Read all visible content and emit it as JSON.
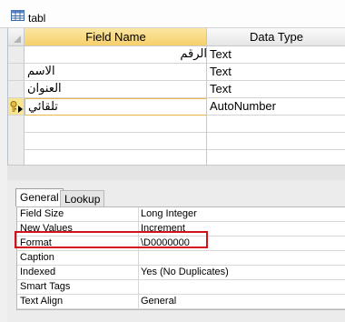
{
  "window": {
    "title": "tabl",
    "icon": "table-icon"
  },
  "grid": {
    "columns": [
      "Field Name",
      "Data Type"
    ],
    "rows": [
      {
        "name": "الرقم",
        "type": "Text"
      },
      {
        "name": "الاسم",
        "type": "Text"
      },
      {
        "name": "العنوان",
        "type": "Text"
      },
      {
        "name": "تلقائي",
        "type": "AutoNumber"
      }
    ],
    "primary_key_icon": "key-icon",
    "current_row_icon": "current-row-arrow-icon"
  },
  "properties": {
    "tabs": [
      "General",
      "Lookup"
    ],
    "active_tab": "General",
    "rows": [
      {
        "label": "Field Size",
        "value": "Long Integer"
      },
      {
        "label": "New Values",
        "value": "Increment"
      },
      {
        "label": "Format",
        "value": "\\D0000000"
      },
      {
        "label": "Caption",
        "value": ""
      },
      {
        "label": "Indexed",
        "value": "Yes (No Duplicates)"
      },
      {
        "label": "Smart Tags",
        "value": ""
      },
      {
        "label": "Text Align",
        "value": "General"
      }
    ]
  },
  "colors": {
    "header_selected": "#f6cf6b",
    "highlight_annotation": "#d2121b",
    "current_cell_border": "#e8b84a"
  }
}
